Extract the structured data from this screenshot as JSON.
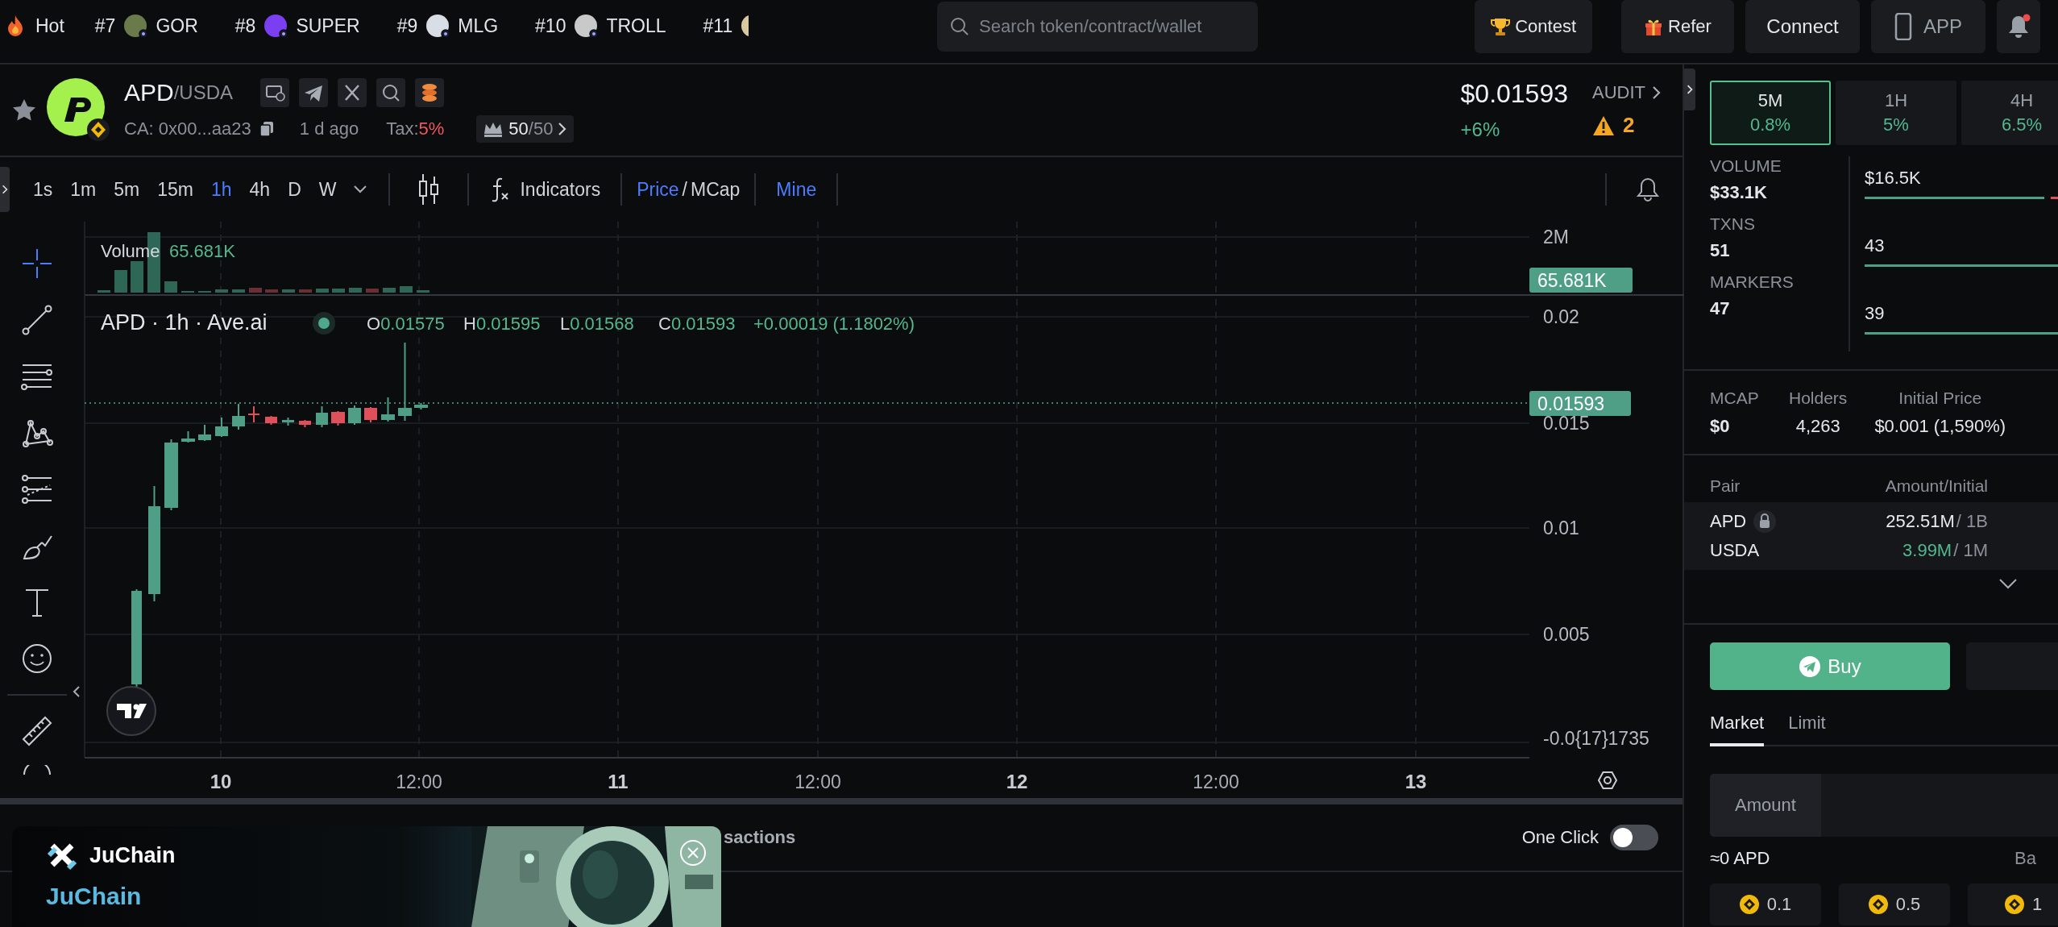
{
  "top_bar": {
    "hot": "Hot",
    "trending": [
      {
        "rank": "#7",
        "symbol": "GOR",
        "color": "#6b7a4a"
      },
      {
        "rank": "#8",
        "symbol": "SUPER",
        "color": "#7b3ff2"
      },
      {
        "rank": "#9",
        "symbol": "MLG",
        "color": "#d8dde6"
      },
      {
        "rank": "#10",
        "symbol": "TROLL",
        "color": "#c9c9c9"
      },
      {
        "rank": "#11",
        "color": "#d9c7a0"
      }
    ],
    "search": {
      "placeholder": "Search token/contract/wallet"
    },
    "buttons": [
      {
        "kind": "contest",
        "label": "Contest"
      },
      {
        "kind": "refer",
        "label": "Refer"
      },
      {
        "kind": "connect",
        "label": "Connect"
      },
      {
        "kind": "app",
        "label": "APP"
      }
    ],
    "notifications": {
      "unread": true
    }
  },
  "token": {
    "favorite": false,
    "symbol": "APD",
    "quote": "/USDA",
    "links": [
      {
        "kind": "website"
      },
      {
        "kind": "telegram"
      },
      {
        "kind": "x"
      },
      {
        "kind": "search"
      },
      {
        "kind": "coins"
      }
    ],
    "contract": "CA: 0x00...aa23",
    "age": "1 d ago",
    "tax_label": "Tax:",
    "tax": "5%",
    "top_count": "50",
    "top_total": "/50",
    "price": "$0.01593",
    "change": "+6%",
    "audit": "AUDIT",
    "warnings": "2"
  },
  "chart_toolbar": {
    "intervals": [
      {
        "label": "1s",
        "selected": false
      },
      {
        "label": "1m",
        "selected": false
      },
      {
        "label": "5m",
        "selected": false
      },
      {
        "label": "15m",
        "selected": false
      },
      {
        "label": "1h",
        "selected": true
      },
      {
        "label": "4h",
        "selected": false
      },
      {
        "label": "D",
        "selected": false
      },
      {
        "label": "W",
        "selected": false
      }
    ],
    "indicators": "Indicators",
    "display": [
      {
        "label": "Price",
        "selected": true
      },
      {
        "label": "MCap",
        "selected": false
      }
    ],
    "display_separator": "/",
    "mine": {
      "label": "Mine",
      "selected": true
    }
  },
  "chart": {
    "volume_label": "Volume",
    "volume_value": "65.681K",
    "volume_axis": "2M",
    "volume_tag": "65.681K",
    "title": "APD · 1h · Ave.ai",
    "ohlc": [
      {
        "key": "O",
        "value": "0.01575"
      },
      {
        "key": "H",
        "value": "0.01595"
      },
      {
        "key": "L",
        "value": "0.01568"
      },
      {
        "key": "C",
        "value": "0.01593"
      }
    ],
    "change": "+0.00019 (1.1802%)",
    "price_tag": "0.01593",
    "price_ticks": [
      "0.02",
      "0.015",
      "0.01",
      "0.005",
      "-0.0{17}1735"
    ],
    "time_ticks": [
      {
        "label": "10",
        "kind": "day"
      },
      {
        "label": "12:00",
        "kind": "time"
      },
      {
        "label": "11",
        "kind": "day"
      },
      {
        "label": "12:00",
        "kind": "time"
      },
      {
        "label": "12",
        "kind": "day"
      },
      {
        "label": "12:00",
        "kind": "time"
      },
      {
        "label": "13",
        "kind": "day"
      }
    ]
  },
  "bottom": {
    "tab": "sactions",
    "one_click": {
      "label": "One Click",
      "on": false
    }
  },
  "ad": {
    "brand": "JuChain",
    "headline": "JuChain"
  },
  "side_panel": {
    "periods": [
      {
        "label": "5M",
        "change": "0.8%",
        "selected": true
      },
      {
        "label": "1H",
        "change": "5%",
        "selected": false
      },
      {
        "label": "4H",
        "change": "6.5%",
        "selected": false
      }
    ],
    "stats": [
      {
        "label": "VOLUME",
        "total": "$33.1K",
        "buys": "$16.5K",
        "level": 0.93
      },
      {
        "label": "TXNS",
        "total": "51",
        "buys": "43",
        "level": 1
      },
      {
        "label": "MARKERS",
        "total": "47",
        "buys": "39",
        "level": 1
      }
    ],
    "summary": [
      {
        "label": "MCAP",
        "value": "$0"
      },
      {
        "label": "Holders",
        "value": "4,263"
      },
      {
        "label": "Initial Price",
        "value": "$0.001 (1,590%)"
      }
    ],
    "pair_header": {
      "pair": "Pair",
      "amount": "Amount/Initial"
    },
    "pair_rows": [
      {
        "token": "APD",
        "locked": true,
        "amount": "252.51M",
        "initial": "/ 1B",
        "highlight": false
      },
      {
        "token": "USDA",
        "locked": false,
        "amount": "3.99M",
        "initial": "/ 1M",
        "highlight": true
      }
    ],
    "trade": {
      "buy": "Buy",
      "order_types": [
        {
          "label": "Market",
          "selected": true
        },
        {
          "label": "Limit",
          "selected": false
        }
      ],
      "amount_label": "Amount",
      "estimate": "≈0 APD",
      "balance": "Ba",
      "quick_amounts": [
        "0.1",
        "0.5",
        "1"
      ]
    }
  }
}
